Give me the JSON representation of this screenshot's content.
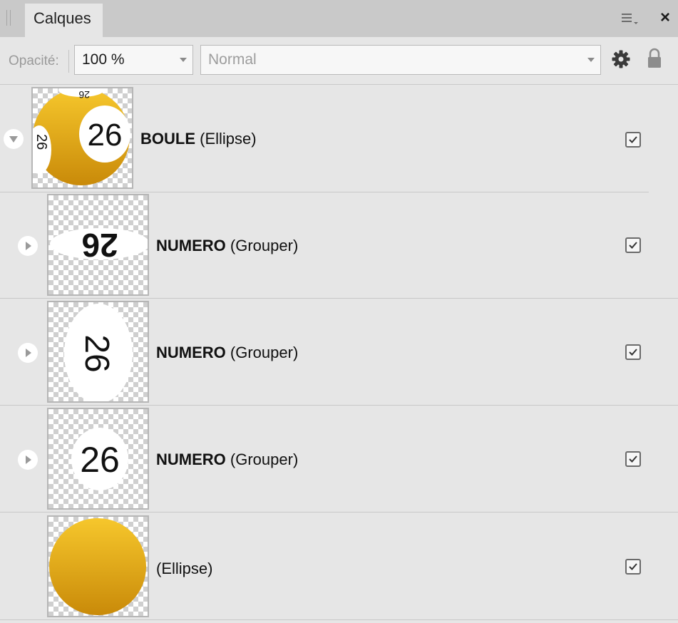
{
  "panel": {
    "tab_label": "Calques",
    "menu_icon": "menu-icon",
    "close_icon": "close-icon",
    "close_glyph": "×"
  },
  "toolbar": {
    "opacity_label": "Opacité:",
    "opacity_value": "100 %",
    "blend_mode": "Normal",
    "settings_icon": "gear-icon",
    "lock_icon": "lock-icon"
  },
  "layers": [
    {
      "name": "BOULE",
      "type": "(Ellipse)",
      "expanded": true,
      "visible": true,
      "depth": 0,
      "thumb_number": "26"
    },
    {
      "name": "NUMERO",
      "type": "(Grouper)",
      "expanded": false,
      "visible": true,
      "depth": 1,
      "thumb_number": "26"
    },
    {
      "name": "NUMERO",
      "type": "(Grouper)",
      "expanded": false,
      "visible": true,
      "depth": 1,
      "thumb_number": "26"
    },
    {
      "name": "NUMERO",
      "type": "(Grouper)",
      "expanded": false,
      "visible": true,
      "depth": 1,
      "thumb_number": "26"
    },
    {
      "name": "",
      "type": "(Ellipse)",
      "expanded": false,
      "visible": true,
      "depth": 1
    }
  ],
  "colors": {
    "ball_top": "#f6c72c",
    "ball_bottom": "#c98a09",
    "panel_bg": "#e6e6e6",
    "tabbar_bg": "#c9c9c9"
  }
}
